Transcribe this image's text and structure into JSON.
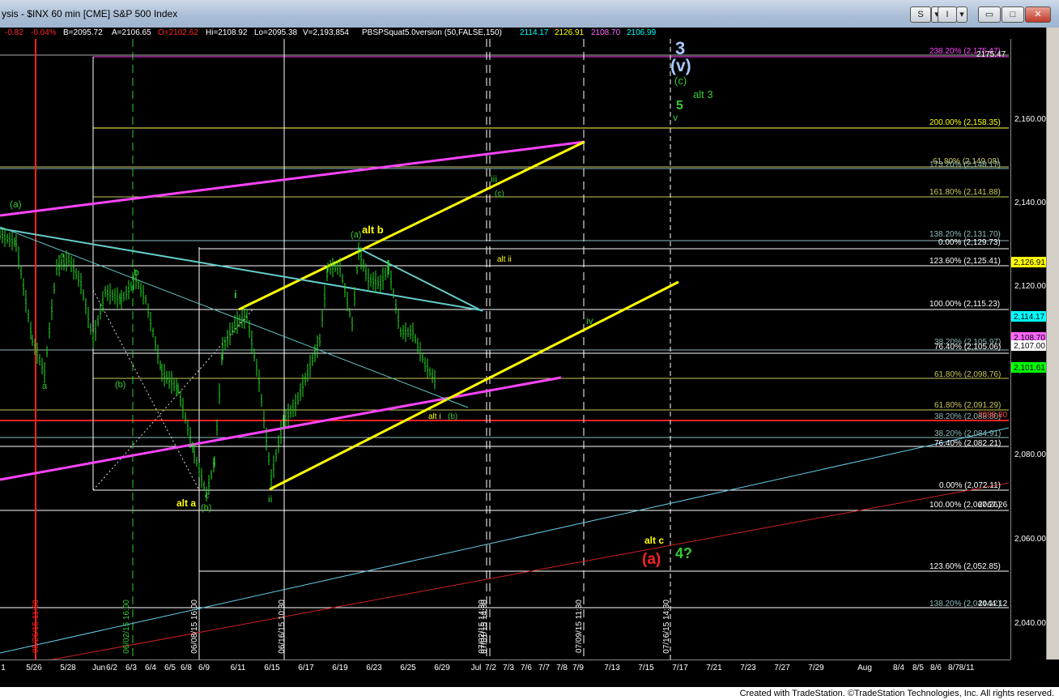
{
  "window": {
    "title": "ysis - $INX 60 min [CME] S&P 500 Index",
    "buttons": {
      "style": "S",
      "info": "I",
      "dropdown": "▾",
      "minimize": "▭",
      "maximize": "□",
      "close": "✕"
    }
  },
  "infobar": {
    "change": "-0.82",
    "change_pct": "-0.04%",
    "bid": "B=2095.72",
    "ask": "A=2106.65",
    "open": "O=2102.62",
    "high": "Hi=2108.92",
    "low": "Lo=2095.38",
    "volume": "V=2,193,854",
    "indicator": "PBSPSquat5.0version (50,FALSE,150)",
    "ind_v1": "2114.17",
    "ind_v2": "2126.91",
    "ind_v3": "2108.70",
    "ind_v4": "2106.99"
  },
  "price_axis": {
    "ticks": [
      "2,160.00",
      "2,140.00",
      "2,120.00",
      "2,100.00",
      "2,080.00",
      "2,060.00",
      "2,040.00"
    ],
    "markers": [
      {
        "text": "2,126.91",
        "color": "#ffff00"
      },
      {
        "text": "2,114.17",
        "color": "#00ffff"
      },
      {
        "text": "2,108.70",
        "color": "#ff66ff"
      },
      {
        "text": "2,107.00",
        "color": "#ffffff"
      },
      {
        "text": "2,101.61",
        "color": "#00ff00"
      }
    ]
  },
  "time_axis": [
    "1",
    "5/26",
    "5/28",
    "Jun",
    "6/2",
    "6/3",
    "6/4",
    "6/5",
    "6/8",
    "6/9",
    "6/11",
    "6/15",
    "6/17",
    "6/19",
    "6/23",
    "6/25",
    "6/29",
    "Jul",
    "7/2",
    "7/3",
    "7/6",
    "7/7",
    "7/8",
    "7/9",
    "7/13",
    "7/15",
    "7/17",
    "7/21",
    "7/23",
    "7/27",
    "7/29",
    "Aug",
    "8/4",
    "8/5",
    "8/6",
    "8/7",
    "8/11"
  ],
  "fib_labels": [
    {
      "text": "238.20% (2,175.47)",
      "color": "#ff44ff"
    },
    {
      "text": "2175.47",
      "color": "#ffffff"
    },
    {
      "text": "200.00% (2,158.35)",
      "color": "#ffff00"
    },
    {
      "text": "61.80% (2,149.08)",
      "color": "#c8c860"
    },
    {
      "text": "173.20% (2,148.17)",
      "color": "#8fbcbc"
    },
    {
      "text": "161.80% (2,141.88)",
      "color": "#c8c860"
    },
    {
      "text": "138.20% (2,131.70)",
      "color": "#8fbcbc"
    },
    {
      "text": "0.00% (2,129.73)",
      "color": "#ffffff"
    },
    {
      "text": "123.60% (2,125.41)",
      "color": "#ffffff"
    },
    {
      "text": "100.00% (2,115.23)",
      "color": "#ffffff"
    },
    {
      "text": "38.20% (2,105.97)",
      "color": "#8fbcbc"
    },
    {
      "text": "76.40% (2,105.06)",
      "color": "#ffffff"
    },
    {
      "text": "61.80% (2,098.76)",
      "color": "#c8c860"
    },
    {
      "text": "61.80% (2,091.29)",
      "color": "#c8c860"
    },
    {
      "text": "38.20% (2,088.80)",
      "color": "#8fbcbc"
    },
    {
      "text": "2088.80",
      "color": "#ff4444"
    },
    {
      "text": "38.20% (2,084.91)",
      "color": "#8fbcbc"
    },
    {
      "text": "76.40% (2,082.21)",
      "color": "#ffffff"
    },
    {
      "text": "0.00% (2,072.11)",
      "color": "#ffffff"
    },
    {
      "text": "100.00% (2,067.26)",
      "color": "#ffffff"
    },
    {
      "text": "2067.26",
      "color": "#ffffff"
    },
    {
      "text": "123.60% (2,052.85)",
      "color": "#ffffff"
    },
    {
      "text": "138.20% (2,044.12)",
      "color": "#8fbcbc"
    },
    {
      "text": "2044.12",
      "color": "#ffffff"
    }
  ],
  "wave_labels": [
    {
      "text": "3",
      "color": "#a8c8ff"
    },
    {
      "text": "(v)",
      "color": "#a8c8ff"
    },
    {
      "text": "(c)",
      "color": "#33cc33"
    },
    {
      "text": "alt 3",
      "color": "#33cc33"
    },
    {
      "text": "5",
      "color": "#33cc33"
    },
    {
      "text": "v",
      "color": "#33cc33"
    },
    {
      "text": "(a)",
      "color": "#33cc33"
    },
    {
      "text": "(a)",
      "color": "#33cc33"
    },
    {
      "text": "alt b",
      "color": "#ffff00"
    },
    {
      "text": "iii",
      "color": "#33cc33"
    },
    {
      "text": "(c)",
      "color": "#33cc33"
    },
    {
      "text": "alt ii",
      "color": "#ffff00"
    },
    {
      "text": "a",
      "color": "#33cc33"
    },
    {
      "text": "b",
      "color": "#33cc33"
    },
    {
      "text": "a",
      "color": "#33cc33"
    },
    {
      "text": "(b)",
      "color": "#33cc33"
    },
    {
      "text": "i",
      "color": "#33cc33"
    },
    {
      "text": "iv",
      "color": "#33cc33"
    },
    {
      "text": "alt i",
      "color": "#ffff00"
    },
    {
      "text": "(b)",
      "color": "#33cc33"
    },
    {
      "text": "c",
      "color": "#33cc33"
    },
    {
      "text": "alt a",
      "color": "#ffff00"
    },
    {
      "text": "(b)",
      "color": "#33cc33"
    },
    {
      "text": "ii",
      "color": "#33cc33"
    },
    {
      "text": "alt c",
      "color": "#ffff00"
    },
    {
      "text": "(a)",
      "color": "#ff2222"
    },
    {
      "text": "4?",
      "color": "#33cc33"
    }
  ],
  "vline_labels": [
    {
      "text": "05/26/15 11:30",
      "color": "#ff2222"
    },
    {
      "text": "06/02/15 16:00",
      "color": "#33cc33"
    },
    {
      "text": "06/08/15 16:00",
      "color": "#ffffff"
    },
    {
      "text": "06/16/15 10:30",
      "color": "#ffffff"
    },
    {
      "text": "07/01/15 14:30",
      "color": "#ffffff"
    },
    {
      "text": "07/02/15 14:30",
      "color": "#ffffff"
    },
    {
      "text": "07/09/15 11:30",
      "color": "#ffffff"
    },
    {
      "text": "07/16/15 14:30",
      "color": "#ffffff"
    }
  ],
  "footer": {
    "credit": "Created with TradeStation. ©TradeStation Technologies, Inc. All rights reserved."
  }
}
